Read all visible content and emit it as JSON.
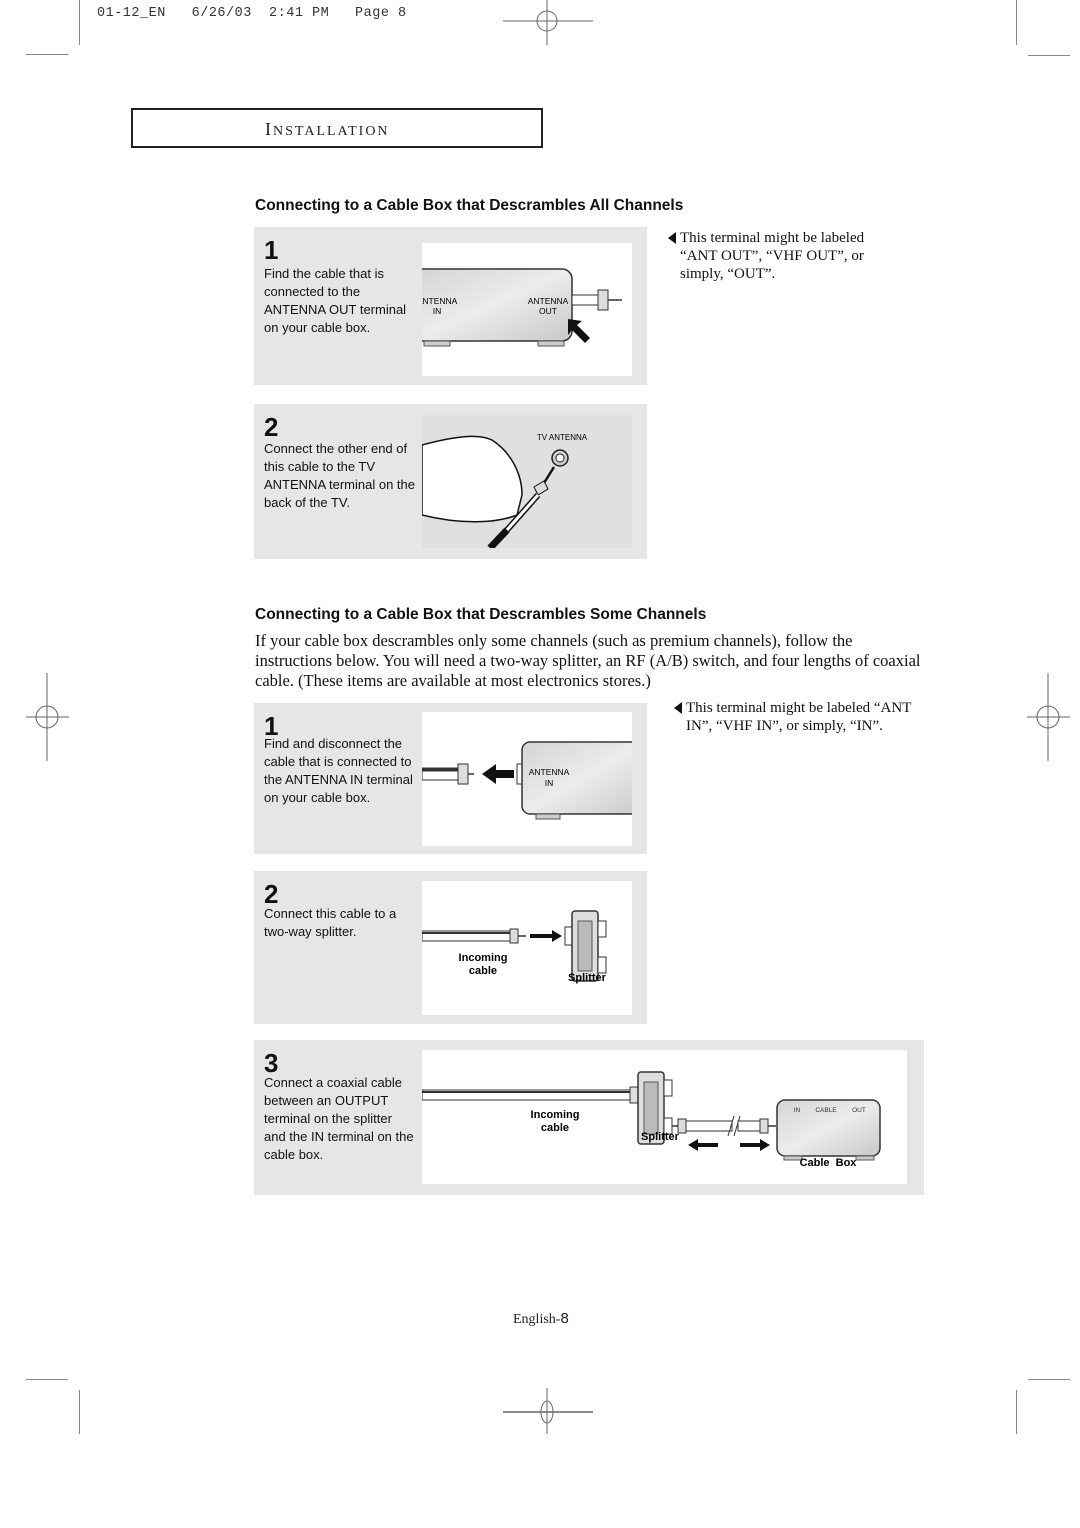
{
  "print_slug": "01-12_EN   6/26/03  2:41 PM   Page 8",
  "section": {
    "title_cap": "I",
    "title_rest": "NSTALLATION"
  },
  "part1": {
    "heading": "Connecting to a Cable Box that Descrambles All Channels",
    "steps": [
      {
        "number": "1",
        "text": "Find the cable that is connected to the ANTENNA OUT terminal on your cable box.",
        "labels": {
          "antenna_in": "ANTENNA\nIN",
          "antenna_in_l1": "ANTENNA",
          "antenna_in_l2": "IN",
          "antenna_out_l1": "ANTENNA",
          "antenna_out_l2": "OUT"
        },
        "note": "This terminal might be labeled “ANT OUT”, “VHF OUT”, or simply, “OUT”."
      },
      {
        "number": "2",
        "text": "Connect the other end of this cable to the TV ANTENNA terminal on the back of the TV.",
        "labels": {
          "tv_antenna": "TV ANTENNA"
        }
      }
    ]
  },
  "part2": {
    "heading": "Connecting to a Cable Box that Descrambles Some Channels",
    "intro": "If your cable box descrambles only some channels (such as premium channels), follow the instructions below. You will need a two-way splitter, an RF (A/B) switch, and four lengths of coaxial cable. (These items are available at most electronics stores.)",
    "steps": [
      {
        "number": "1",
        "text": "Find and disconnect the cable that is connected to the ANTENNA IN terminal on your cable box.",
        "labels": {
          "antenna_l1": "ANTENNA",
          "antenna_l2": "IN"
        },
        "note": "This terminal might be labeled “ANT IN”, “VHF IN”, or simply, “IN”."
      },
      {
        "number": "2",
        "text": "Connect this cable to a two-way splitter.",
        "labels": {
          "incoming_l1": "Incoming",
          "incoming_l2": "cable",
          "splitter": "Splitter"
        }
      },
      {
        "number": "3",
        "text": "Connect a coaxial cable between an OUTPUT terminal on the splitter and the IN terminal on the cable box.",
        "labels": {
          "incoming_l1": "Incoming",
          "incoming_l2": "cable",
          "splitter": "Splitter",
          "box_in": "IN",
          "box_cable": "CABLE",
          "box_out": "OUT",
          "cable_box": "Cable  Box"
        }
      }
    ]
  },
  "footer": {
    "language": "English-",
    "page_number": "8"
  }
}
